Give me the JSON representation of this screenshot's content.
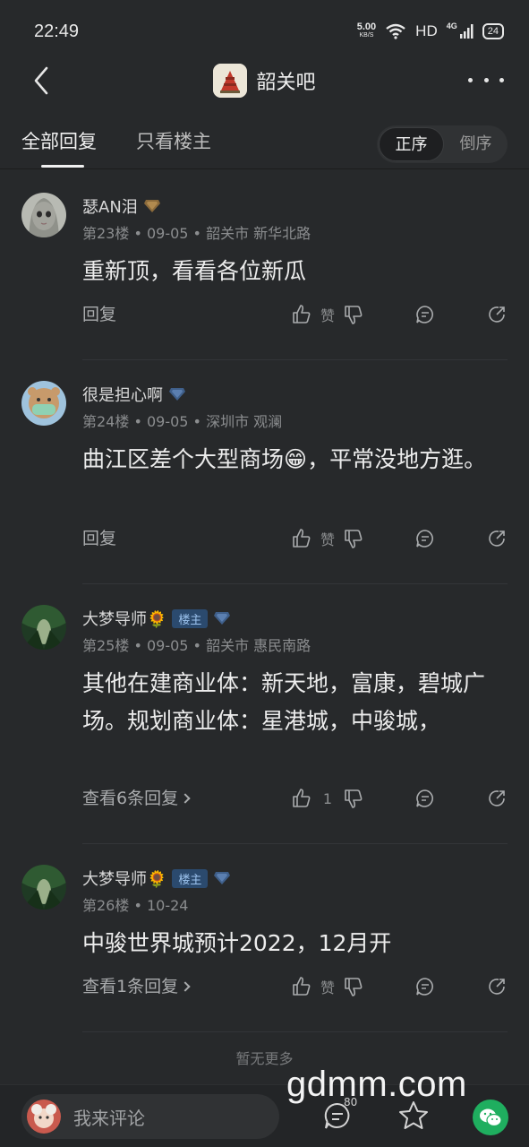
{
  "status_bar": {
    "time": "22:49",
    "speed_value": "5.00",
    "speed_unit": "KB/S",
    "hd": "HD",
    "net": "4G",
    "battery": "24"
  },
  "header": {
    "title": "韶关吧",
    "back_icon": "chevron-left-icon",
    "more_icon": "more-dots-icon"
  },
  "tabs": {
    "all": "全部回复",
    "owner_only": "只看楼主",
    "order_asc": "正序",
    "order_desc": "倒序"
  },
  "posts": [
    {
      "username": "瑟AN泪",
      "owner_badge": "",
      "meta": "第23楼 • 09-05 • 韶关市 新华北路",
      "content": "重新顶，看看各位新瓜",
      "reply_label": "回复",
      "like_label": "赞"
    },
    {
      "username": "很是担心啊",
      "owner_badge": "",
      "meta": "第24楼 • 09-05 • 深圳市 观澜",
      "content": "曲江区差个大型商场😁，平常没地方逛。",
      "reply_label": "回复",
      "like_label": "赞"
    },
    {
      "username": "大梦导师🌻",
      "owner_badge": "楼主",
      "meta": "第25楼 • 09-05 • 韶关市 惠民南路",
      "content": "其他在建商业体：新天地，富康，碧城广场。规划商业体：星港城，中骏城，",
      "reply_label": "查看6条回复",
      "like_label": "1"
    },
    {
      "username": "大梦导师🌻",
      "owner_badge": "楼主",
      "meta": "第26楼 • 10-24",
      "content": "中骏世界城预计2022，12月开",
      "reply_label": "查看1条回复",
      "like_label": "赞"
    }
  ],
  "footer": {
    "no_more": "暂无更多",
    "comment_placeholder": "我来评论",
    "comment_count": "80",
    "watermark": "gdmm.com"
  },
  "colors": {
    "background": "#27292b",
    "owner_badge_bg": "#2b4a6e",
    "wechat_green": "#1fae5f"
  }
}
